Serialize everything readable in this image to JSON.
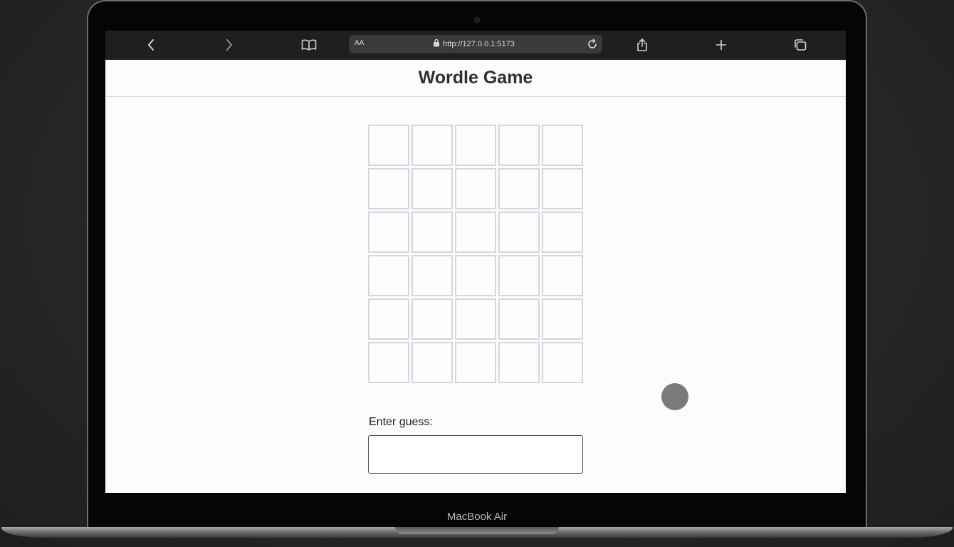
{
  "browser": {
    "text_size_label": "AA",
    "url": "http://127.0.0.1:5173"
  },
  "page": {
    "title": "Wordle Game",
    "grid": {
      "rows": [
        [
          "",
          "",
          "",
          "",
          ""
        ],
        [
          "",
          "",
          "",
          "",
          ""
        ],
        [
          "",
          "",
          "",
          "",
          ""
        ],
        [
          "",
          "",
          "",
          "",
          ""
        ],
        [
          "",
          "",
          "",
          "",
          ""
        ],
        [
          "",
          "",
          "",
          "",
          ""
        ]
      ]
    },
    "guess": {
      "label": "Enter guess:",
      "value": "",
      "placeholder": ""
    }
  },
  "device": {
    "label": "MacBook Air"
  },
  "icons": {
    "back": "chevron-left-icon",
    "forward": "chevron-right-icon",
    "bookmarks": "book-icon",
    "lock": "lock-icon",
    "reload": "reload-icon",
    "share": "share-icon",
    "new_tab": "plus-icon",
    "tabs": "tabs-overview-icon"
  }
}
